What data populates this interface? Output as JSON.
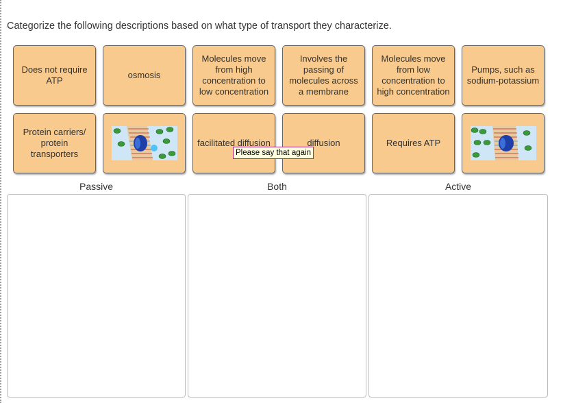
{
  "instruction": "Categorize the following descriptions based on what type of transport they characterize.",
  "tiles_row1": [
    "Does not require ATP",
    "osmosis",
    "Molecules move from high concentration to low concentration",
    "Involves the passing of molecules across a membrane",
    "Molecules move from low concentration to high concentration",
    "Pumps, such as sodium-potassium"
  ],
  "tiles_row2": {
    "t1": "Protein carriers/ protein transporters",
    "t2_image": "carrier-protein-membrane-image",
    "t3": "facilitated diffusion",
    "t4": "diffusion",
    "t5": "Requires ATP",
    "t6_image": "pump-protein-membrane-image"
  },
  "tooltip": "Please say that again",
  "zones": {
    "passive": "Passive",
    "both": "Both",
    "active": "Active"
  },
  "colors": {
    "tile_bg": "#f8ca8d",
    "tooltip_bg": "#ffffe1",
    "tooltip_border": "#b32b6b"
  }
}
